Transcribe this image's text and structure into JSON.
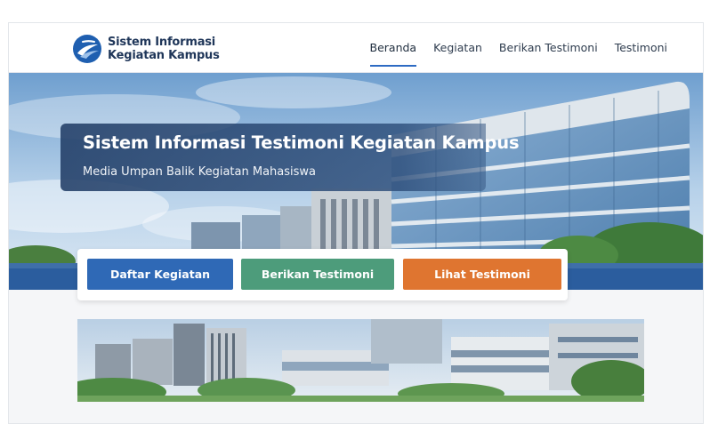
{
  "brand": {
    "line1": "Sistem Informasi",
    "line2": "Kegiatan Kampus",
    "logo_icon": "campus-swoosh-icon"
  },
  "nav": {
    "items": [
      {
        "label": "Beranda",
        "active": true
      },
      {
        "label": "Kegiatan",
        "active": false
      },
      {
        "label": "Berikan Testimoni",
        "active": false
      },
      {
        "label": "Testimoni",
        "active": false
      }
    ]
  },
  "hero": {
    "title": "Sistem Informasi Testimoni Kegiatan Kampus",
    "subtitle": "Media Umpan Balik Kegiatan Mahasiswa"
  },
  "actions": {
    "list_button": "Daftar Kegiatan",
    "give_button": "Berikan Testimoni",
    "view_button": "Lihat Testimoni"
  },
  "colors": {
    "primary": "#2f69b6",
    "green": "#4d9c7b",
    "orange": "#df7530",
    "nav_underline": "#2d6bc3"
  }
}
